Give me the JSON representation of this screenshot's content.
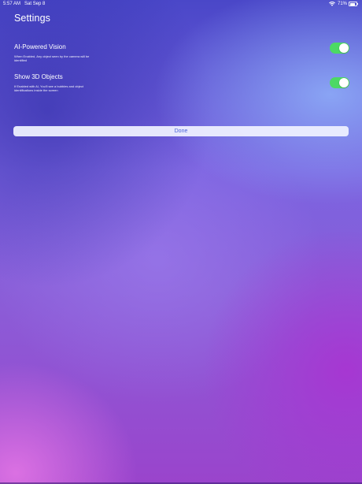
{
  "status_bar": {
    "time": "5:57 AM",
    "date": "Sat Sep 8",
    "battery": "71%",
    "wifi_icon": "wifi-icon",
    "battery_icon": "battery-icon"
  },
  "page": {
    "title": "Settings"
  },
  "settings": [
    {
      "title": "AI-Powered Vision",
      "description": "When Enabled, Any object seen by the camera will be identified",
      "enabled": true
    },
    {
      "title": "Show 3D Objects",
      "description": "If Enabled with AI, You'll see a bubbles and object identifications inside the screen",
      "enabled": true
    }
  ],
  "done_button": {
    "label": "Done"
  },
  "colors": {
    "toggle_on": "#4cd964",
    "button_text": "#4a62d8"
  }
}
